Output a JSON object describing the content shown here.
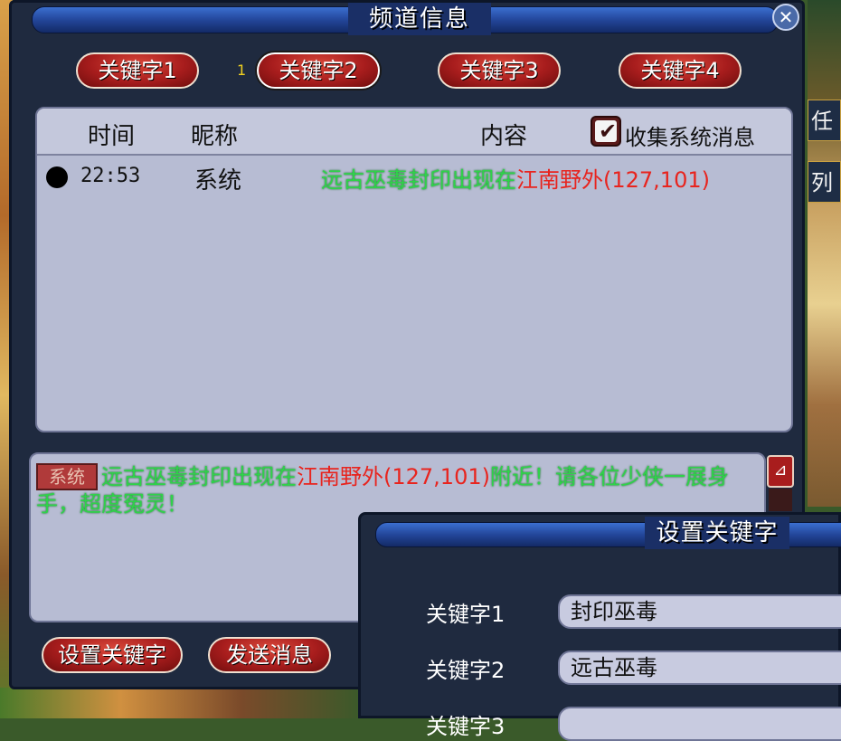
{
  "window": {
    "title": "频道信息",
    "close_glyph": "✕"
  },
  "tabs": [
    {
      "label": "关键字1"
    },
    {
      "label": "关键字2"
    },
    {
      "label": "关键字3"
    },
    {
      "label": "关键字4"
    }
  ],
  "tab_indicator": "1",
  "list": {
    "headers": {
      "time": "时间",
      "nick": "昵称",
      "content": "内容"
    },
    "collect_system_label": "收集系统消息",
    "collect_system_checked": true,
    "rows": [
      {
        "time": "22:53",
        "nick": "系统",
        "content_green": "远古巫毒封印出现在",
        "content_red": "江南野外(127,101)"
      }
    ]
  },
  "message": {
    "tag": "系统",
    "part1_green": "远古巫毒封印出现在",
    "part2_red": "江南野外(127,101)",
    "part3_green": "附近！请各位少侠一展身手，超度冤灵！"
  },
  "buttons": {
    "set_keywords": "设置关键字",
    "send_message": "发送消息"
  },
  "keyword_dialog": {
    "title": "设置关键字",
    "fields": [
      {
        "label": "关键字1",
        "value": "封印巫毒"
      },
      {
        "label": "关键字2",
        "value": "远古巫毒"
      },
      {
        "label": "关键字3",
        "value": ""
      }
    ]
  },
  "side_tabs": [
    {
      "label": "任务"
    },
    {
      "label": "列表"
    }
  ],
  "colors": {
    "highlight_green": "#2fd24a",
    "highlight_red": "#e8241e",
    "button_red": "#a81d1d",
    "panel_bg": "#b7bcd3",
    "window_bg": "#1f2a3f"
  }
}
